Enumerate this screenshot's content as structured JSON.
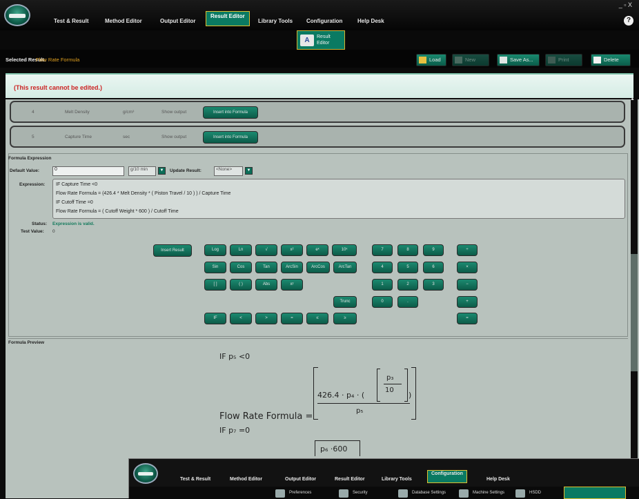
{
  "top_menu": {
    "items": [
      "Test & Result",
      "Method Editor",
      "Output Editor",
      "Result Editor",
      "Library Tools",
      "Configuration",
      "Help Desk"
    ],
    "active": "Result Editor",
    "window_controls": "_ ▫ X",
    "help": "?"
  },
  "subbar": {
    "tab_label": "Result Editor",
    "tab_icon": "result-editor-icon"
  },
  "selected_result": {
    "label": "Selected Result:",
    "value": "Flow Rate Formula"
  },
  "toolbar": {
    "load": "Load",
    "new": "New",
    "save_as": "Save As...",
    "print": "Print",
    "delete": "Delete"
  },
  "warning": "(This result cannot be edited.)",
  "param_rows": [
    {
      "index": "4",
      "name": "Melt Density",
      "unit": "g/cm³",
      "display": "Show output",
      "button": "Insert into Formula"
    },
    {
      "index": "5",
      "name": "Capture Time",
      "unit": "sec",
      "display": "Show output",
      "button": "Insert into Formula"
    }
  ],
  "formula_expression": {
    "section_title": "Formula Expression",
    "default_value_label": "Default Value:",
    "default_value": "0",
    "unit": "g/10 min",
    "update_result_label": "Update Result:",
    "update_result": "<None>",
    "expression_label": "Expression:",
    "expression_lines": [
      "IF Capture Time <0",
      "Flow Rate Formula = (426.4 * Melt Density * ( Piston Travel / 10 ) ) / Capture Time",
      "IF Cutoff Time =0",
      "Flow Rate Formula = ( Cutoff Weight * 600 ) / Cutoff Time"
    ],
    "status_label": "Status:",
    "status_value": "Expression is valid.",
    "test_value_label": "Test Value:",
    "test_value": "0"
  },
  "keypad": {
    "insert_result": "Insert Result",
    "functions_row1": [
      "Log",
      "Ln",
      "√",
      "x²",
      "eˣ",
      "10ˣ"
    ],
    "functions_row2": [
      "Sin",
      "Cos",
      "Tan",
      "ArcSin",
      "ArcCos",
      "ArcTan"
    ],
    "functions_row3": [
      "[ ]",
      "( )",
      "Abs",
      "xʸ"
    ],
    "functions_row4": [
      "Trunc"
    ],
    "compare_row": [
      "IF",
      "<",
      ">",
      "=",
      "≤",
      "≥"
    ],
    "digits": [
      "7",
      "8",
      "9",
      "4",
      "5",
      "6",
      "1",
      "2",
      "3",
      "0",
      "."
    ],
    "operators": [
      "÷",
      "×",
      "−",
      "+",
      "="
    ]
  },
  "formula_preview": {
    "section_title": "Formula Preview",
    "line1": "IF p₅ <0",
    "numerator_coef": "426.4 · p₄ · (",
    "inner_num": "p₃",
    "inner_den": "10",
    "inner_close": ")",
    "denominator": "p₅",
    "result_label": "Flow Rate Formula =",
    "line3": "IF p₇ =0",
    "partial": "p₆ ·600"
  },
  "overlay": {
    "items": [
      "Test & Result",
      "Method Editor",
      "Output Editor",
      "Result Editor",
      "Library Tools",
      "Configuration",
      "Help Desk"
    ],
    "active": "Configuration",
    "sub_tabs": [
      "Preferences",
      "Security",
      "Database Settings",
      "Machine Settings",
      "HSDD"
    ]
  },
  "colors": {
    "accent": "#0a7a62",
    "gold_border": "#e0c030",
    "warning": "#cc2222",
    "panel": "#b8c2bd"
  }
}
